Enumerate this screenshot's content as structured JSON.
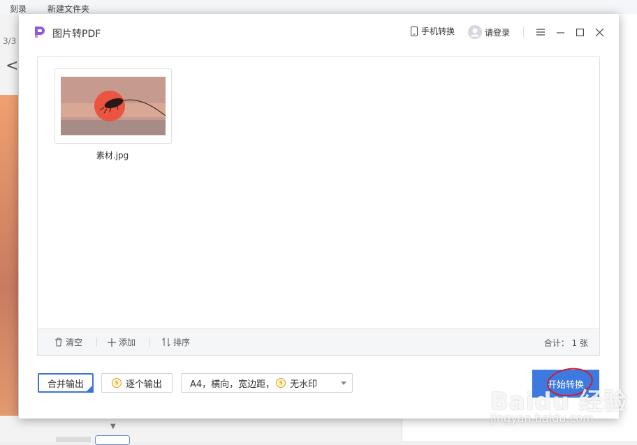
{
  "background_app": {
    "toolbar_items": [
      "刻录",
      "新建文件夹"
    ],
    "page_counter": "3/3",
    "back_glyph": "<"
  },
  "dialog": {
    "app_title": "图片转PDF",
    "logo_icon": "pdf-p-logo-icon",
    "phone_convert_label": "手机转换",
    "login_label": "请登录",
    "menu_icon": "hamburger-menu-icon",
    "minimize_icon": "minimize-icon",
    "maximize_icon": "maximize-icon",
    "close_icon": "close-icon"
  },
  "files": [
    {
      "name": "素材.jpg"
    }
  ],
  "panel_footer": {
    "clear_label": "清空",
    "add_label": "添加",
    "sort_label": "排序",
    "total_label": "合计：",
    "total_value": "1 张"
  },
  "options": {
    "merge_output_label": "合并输出",
    "single_output_label": "逐个输出",
    "page_setting_parts": {
      "main": "A4，横向，宽边距，",
      "watermark": "无水印"
    },
    "start_label": "开始转换"
  },
  "watermark": {
    "text": "Baidu 经验",
    "sub": "jingyan.baidu.com"
  },
  "colors": {
    "accent": "#3d7ae0",
    "logo": "#8b5cd6",
    "annotation_circle": "#d11a2a"
  }
}
